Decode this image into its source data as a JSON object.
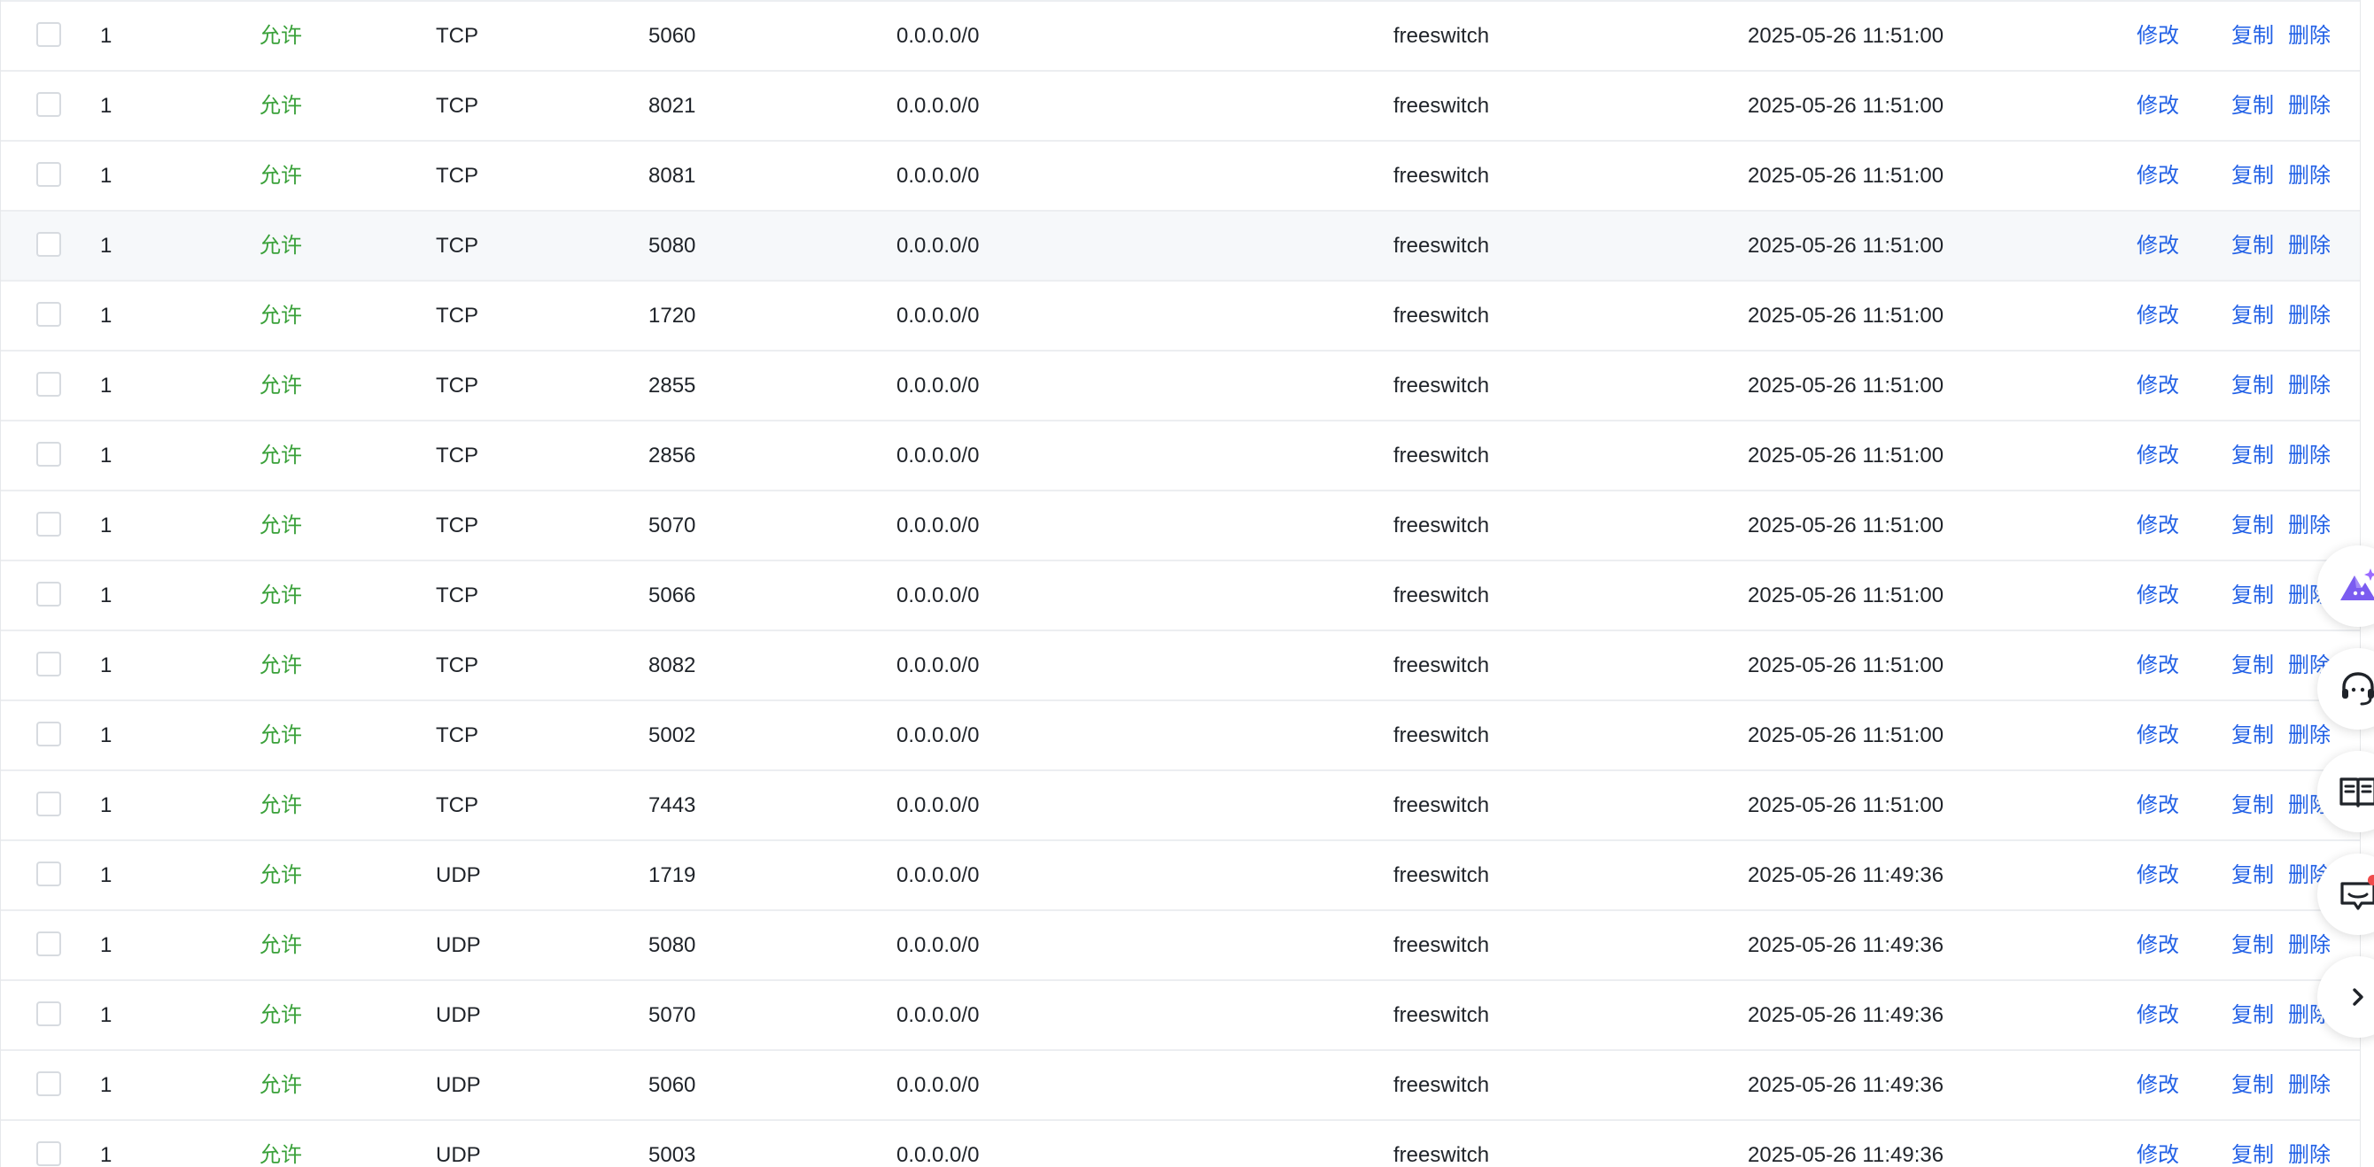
{
  "actions": {
    "edit": "修改",
    "copy": "复制",
    "delete": "删除"
  },
  "colors": {
    "policy_allow": "#3aa13a",
    "action_link": "#2160e6",
    "row_hover": "#f6f8fa"
  },
  "hovered_row_index": 3,
  "rules": [
    {
      "priority": "1",
      "policy": "允许",
      "protocol": "TCP",
      "port": "5060",
      "source": "0.0.0.0/0",
      "description": "freeswitch",
      "time": "2025-05-26 11:51:00"
    },
    {
      "priority": "1",
      "policy": "允许",
      "protocol": "TCP",
      "port": "8021",
      "source": "0.0.0.0/0",
      "description": "freeswitch",
      "time": "2025-05-26 11:51:00"
    },
    {
      "priority": "1",
      "policy": "允许",
      "protocol": "TCP",
      "port": "8081",
      "source": "0.0.0.0/0",
      "description": "freeswitch",
      "time": "2025-05-26 11:51:00"
    },
    {
      "priority": "1",
      "policy": "允许",
      "protocol": "TCP",
      "port": "5080",
      "source": "0.0.0.0/0",
      "description": "freeswitch",
      "time": "2025-05-26 11:51:00"
    },
    {
      "priority": "1",
      "policy": "允许",
      "protocol": "TCP",
      "port": "1720",
      "source": "0.0.0.0/0",
      "description": "freeswitch",
      "time": "2025-05-26 11:51:00"
    },
    {
      "priority": "1",
      "policy": "允许",
      "protocol": "TCP",
      "port": "2855",
      "source": "0.0.0.0/0",
      "description": "freeswitch",
      "time": "2025-05-26 11:51:00"
    },
    {
      "priority": "1",
      "policy": "允许",
      "protocol": "TCP",
      "port": "2856",
      "source": "0.0.0.0/0",
      "description": "freeswitch",
      "time": "2025-05-26 11:51:00"
    },
    {
      "priority": "1",
      "policy": "允许",
      "protocol": "TCP",
      "port": "5070",
      "source": "0.0.0.0/0",
      "description": "freeswitch",
      "time": "2025-05-26 11:51:00"
    },
    {
      "priority": "1",
      "policy": "允许",
      "protocol": "TCP",
      "port": "5066",
      "source": "0.0.0.0/0",
      "description": "freeswitch",
      "time": "2025-05-26 11:51:00"
    },
    {
      "priority": "1",
      "policy": "允许",
      "protocol": "TCP",
      "port": "8082",
      "source": "0.0.0.0/0",
      "description": "freeswitch",
      "time": "2025-05-26 11:51:00"
    },
    {
      "priority": "1",
      "policy": "允许",
      "protocol": "TCP",
      "port": "5002",
      "source": "0.0.0.0/0",
      "description": "freeswitch",
      "time": "2025-05-26 11:51:00"
    },
    {
      "priority": "1",
      "policy": "允许",
      "protocol": "TCP",
      "port": "7443",
      "source": "0.0.0.0/0",
      "description": "freeswitch",
      "time": "2025-05-26 11:51:00"
    },
    {
      "priority": "1",
      "policy": "允许",
      "protocol": "UDP",
      "port": "1719",
      "source": "0.0.0.0/0",
      "description": "freeswitch",
      "time": "2025-05-26 11:49:36"
    },
    {
      "priority": "1",
      "policy": "允许",
      "protocol": "UDP",
      "port": "5080",
      "source": "0.0.0.0/0",
      "description": "freeswitch",
      "time": "2025-05-26 11:49:36"
    },
    {
      "priority": "1",
      "policy": "允许",
      "protocol": "UDP",
      "port": "5070",
      "source": "0.0.0.0/0",
      "description": "freeswitch",
      "time": "2025-05-26 11:49:36"
    },
    {
      "priority": "1",
      "policy": "允许",
      "protocol": "UDP",
      "port": "5060",
      "source": "0.0.0.0/0",
      "description": "freeswitch",
      "time": "2025-05-26 11:49:36"
    },
    {
      "priority": "1",
      "policy": "允许",
      "protocol": "UDP",
      "port": "5003",
      "source": "0.0.0.0/0",
      "description": "freeswitch",
      "time": "2025-05-26 11:49:36"
    }
  ],
  "float_tools": [
    {
      "icon": "ai-assistant-icon"
    },
    {
      "icon": "customer-service-icon"
    },
    {
      "icon": "docs-book-icon"
    },
    {
      "icon": "feedback-message-icon",
      "badge": "red-dot"
    },
    {
      "icon": "chevron-right-icon"
    }
  ]
}
